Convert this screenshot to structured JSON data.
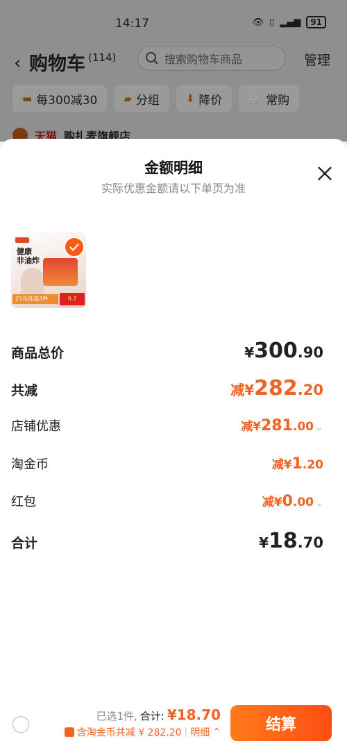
{
  "status_bar": {
    "time": "14:17",
    "battery": "91"
  },
  "cart": {
    "title": "购物车",
    "count": "(114)",
    "search_placeholder": "搜索购物车商品",
    "manage": "管理",
    "chips": [
      "每300减30",
      "分组",
      "降价",
      "常购"
    ],
    "store_tmall": "天猫",
    "store_name": "购扎麦旗舰店"
  },
  "sheet": {
    "title": "金额明细",
    "subtitle": "实际优惠金额请以下单页为准",
    "product": {
      "title_line1": "健康",
      "title_line2": "非油炸",
      "promo": "25元任选3件",
      "price": "9.7"
    },
    "rows": [
      {
        "label": "商品总价",
        "prefix": "",
        "sym": "¥",
        "int": "300",
        "dec": ".90"
      },
      {
        "label": "共减",
        "prefix": "减",
        "sym": "¥",
        "int": "282",
        "dec": ".20"
      },
      {
        "label": "店铺优惠",
        "prefix": "减",
        "sym": "¥",
        "int": "281",
        "dec": ".00"
      },
      {
        "label": "淘金币",
        "prefix": "减",
        "sym": "¥",
        "int": "1",
        "dec": ".20"
      },
      {
        "label": "红包",
        "prefix": "减",
        "sym": "¥",
        "int": "0",
        "dec": ".00"
      },
      {
        "label": "合计",
        "prefix": "",
        "sym": "¥",
        "int": "18",
        "dec": ".70"
      }
    ]
  },
  "bottom": {
    "selected": "已选1件,",
    "total_label": "合计:",
    "total_value": "¥18.70",
    "coin_text": "含淘金币共减 ¥ 282.20",
    "detail": "明细",
    "checkout": "结算"
  },
  "colors": {
    "accent": "#f06323",
    "checkout_start": "#ff7a1a",
    "checkout_end": "#ff4d12"
  }
}
